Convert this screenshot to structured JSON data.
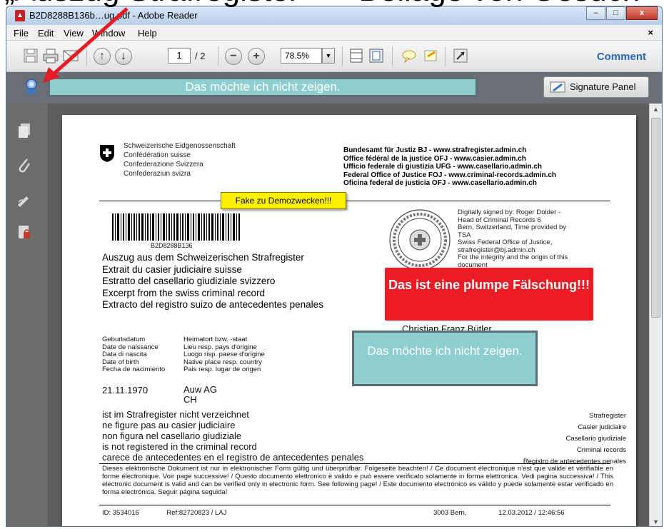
{
  "slide": {
    "heading_partial": "„Auszug Strafregister“ — Beilage von Gesuch"
  },
  "window": {
    "title": "B2D8288B136b…ug.pdf - Adobe Reader",
    "app_icon": "adobe-reader-icon",
    "buttons": {
      "minimize": "–",
      "maximize": "□",
      "close": "x"
    }
  },
  "menu": {
    "items": [
      "File",
      "Edit",
      "View",
      "Window",
      "Help"
    ],
    "close_glyph": "×"
  },
  "toolbar": {
    "page_current": "1",
    "page_total": "/ 2",
    "zoom": "78.5%",
    "zoom_arrow": "▼",
    "comment": "Comment",
    "zoom_out": "−",
    "zoom_in": "+",
    "prev": "↑",
    "next": "↓"
  },
  "signature_bar": {
    "hidden_text": "Das möchte ich nicht zeigen.",
    "panel_button": "Signature Panel"
  },
  "document": {
    "gov_lines": [
      "Schweizerische Eidgenossenschaft",
      "Confédération suisse",
      "Confederazione Svizzera",
      "Confederaziun svizra"
    ],
    "office_lines": [
      "Bundesamt für Justiz BJ - www.strafregister.admin.ch",
      "Office fédéral de la justice OFJ - www.casier.admin.ch",
      "Ufficio federale di giustizia UFG - www.casellario.admin.ch",
      "Federal Office of Justice FOJ - www.criminal-records.admin.ch",
      "Oficina federal de justicia OFJ - www.casellario.admin.ch"
    ],
    "sticker": "Fake zu Demozwecken!!!",
    "barcode_number": "B2D8288B136",
    "digital_signature": [
      "Digitally signed by: Roger Dolder -",
      "Head of Criminal Records 6",
      "Bern, Switzerland, Time provided by",
      "TSA",
      "Swiss Federal Office of Justice,",
      "strafregister@bj.admin.ch",
      "For the integrity and the origin of this",
      "document"
    ],
    "extract_titles": [
      "Auszug aus dem Schweizerischen Strafregister",
      "Extrait du casier judiciaire suisse",
      "Estratto del casellario giudiziale svizzero",
      "Excerpt from the swiss criminal record",
      "Extracto del registro suizo de antecedentes penales"
    ],
    "fake_warning": "Das ist eine plumpe Fälschung!!!",
    "person_name": "Christian Franz Bütler",
    "hidden_text_2": "Das möchte ich nicht zeigen.",
    "birth_labels": [
      "Geburtsdatum",
      "Date de naissance",
      "Data di nascita",
      "Date of birth",
      "Fecha de nacimiento"
    ],
    "origin_labels": [
      "Heimatort bzw. -staat",
      "Lieu resp. pays d'origine",
      "Luogo risp. paese d'origine",
      "Native place resp. country",
      "Pais resp. lugar de origen"
    ],
    "birth_date": "21.11.1970",
    "origin_place": "Auw AG",
    "origin_country": "CH",
    "status_lines": [
      "ist im Strafregister nicht verzeichnet",
      "ne figure pas au casier judiciaire",
      "non figura nel casellario giudiziale",
      "is not registered in the criminal record",
      "carece de antecedentes en el registro de antecedentes penales"
    ],
    "register_names": [
      "Strafregister",
      "Casier judiciaire",
      "Casellario giudiziale",
      "Criminal records",
      "Registro de antecedentes penales"
    ],
    "legal_text": "Dieses elektronische Dokument ist nur in elektronischer Form gültig und überprüfbar. Folgeseite beachten! / Ce document électronique n'est que valide et vérifiable en forme électronique. Voir page successive! / Questo documento elettronico è valido e può essere verificato solamente in forma elettronica. Vedi pagina successiva! / This electronic document is valid and can be verified only in electronic form. See following page! / Este documento electrónico es válido y puede solamente estar verificado en forma electrónica. Seguir página seguida!",
    "footer_id": "ID: 3534016",
    "footer_ref": "Ref:82720823 / LAJ",
    "footer_place": "3003 Bern,",
    "footer_datetime": "12.03.2012  /  12:46:56"
  },
  "colors": {
    "red_box": "#ed1c24",
    "hidden_box": "#8ecdd0",
    "sticker": "#fff200",
    "comment_link": "#2b67b8"
  }
}
